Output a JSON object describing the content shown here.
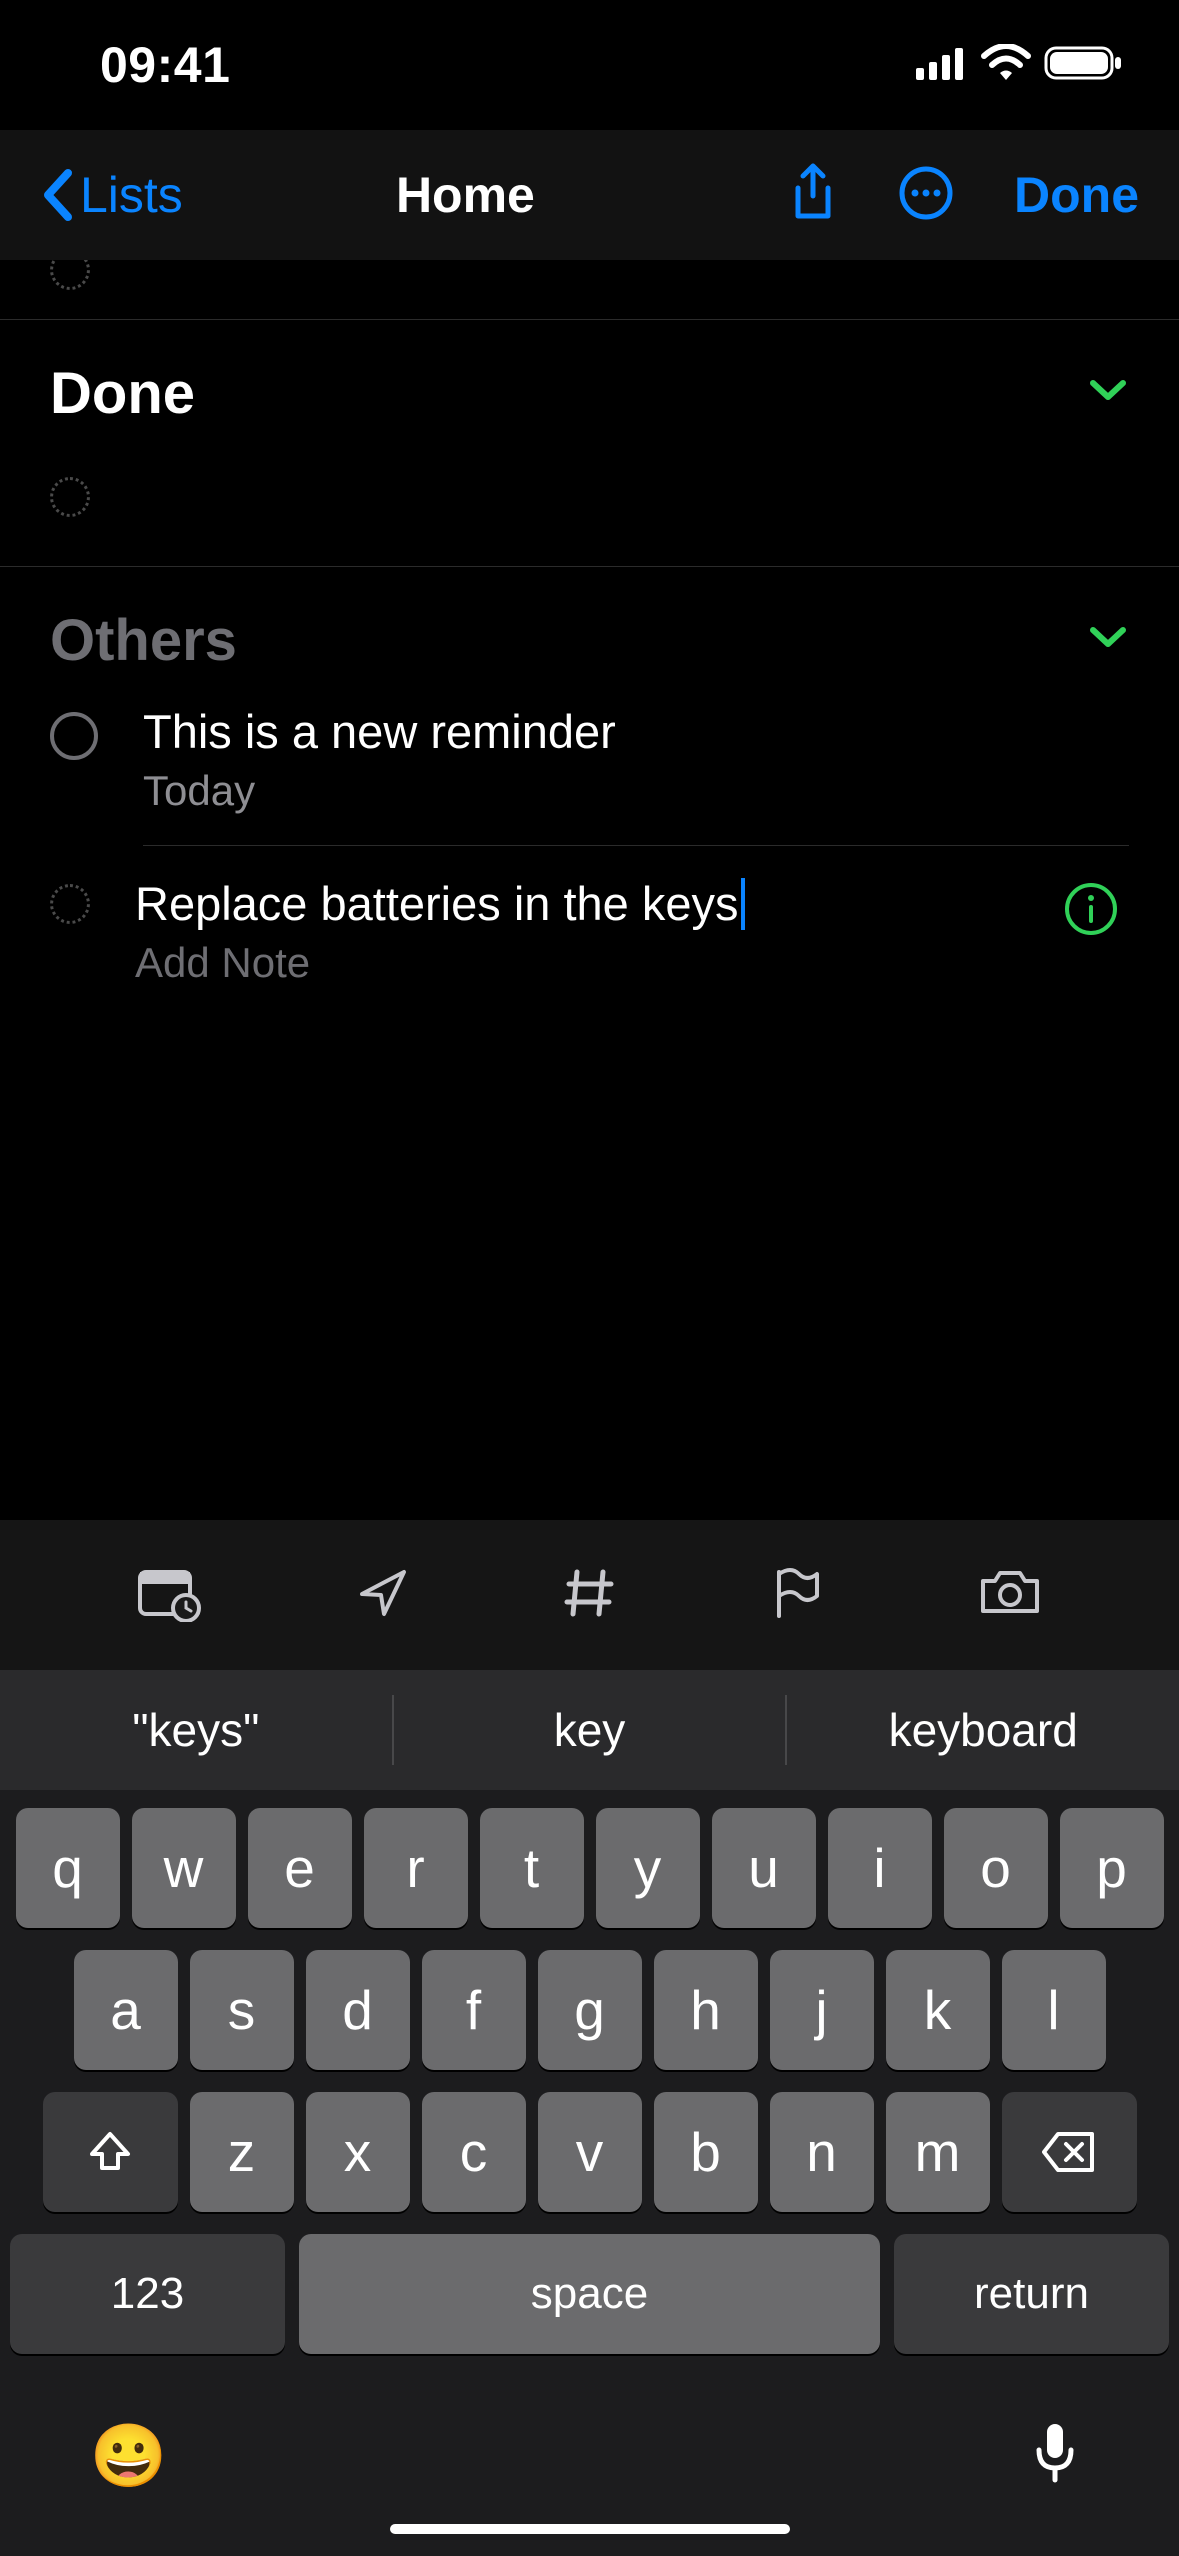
{
  "status": {
    "time": "09:41"
  },
  "nav": {
    "back_label": "Lists",
    "title": "Home",
    "done_label": "Done"
  },
  "sections": {
    "done": {
      "title": "Done"
    },
    "others": {
      "title": "Others",
      "items": [
        {
          "title": "This is a new reminder",
          "subtitle": "Today"
        },
        {
          "title": "Replace batteries in the keys",
          "note_placeholder": "Add Note"
        }
      ]
    }
  },
  "suggestions": [
    "\"keys\"",
    "key",
    "keyboard"
  ],
  "keyboard": {
    "row1": [
      "q",
      "w",
      "e",
      "r",
      "t",
      "y",
      "u",
      "i",
      "o",
      "p"
    ],
    "row2": [
      "a",
      "s",
      "d",
      "f",
      "g",
      "h",
      "j",
      "k",
      "l"
    ],
    "row3": [
      "z",
      "x",
      "c",
      "v",
      "b",
      "n",
      "m"
    ],
    "numeric_label": "123",
    "space_label": "space",
    "return_label": "return"
  }
}
